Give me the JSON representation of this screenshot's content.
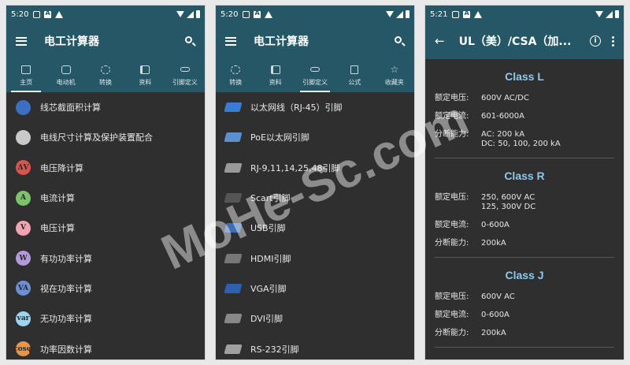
{
  "status": {
    "time_1": "5:20",
    "time_2": "5:20",
    "time_3": "5:21"
  },
  "screen1": {
    "title": "电工计算器",
    "tabs": [
      {
        "label": "主页",
        "icon": "home-icon"
      },
      {
        "label": "电动机",
        "icon": "motor-icon"
      },
      {
        "label": "转换",
        "icon": "convert-icon"
      },
      {
        "label": "资料",
        "icon": "book-icon"
      },
      {
        "label": "引脚定义",
        "icon": "pinout-icon"
      }
    ],
    "items": [
      {
        "label": "线芯截面积计算",
        "badge": "",
        "color": "#3b6fc4"
      },
      {
        "label": "电线尺寸计算及保护装置配合",
        "badge": "",
        "color": "#c9c9c9"
      },
      {
        "label": "电压降计算",
        "badge": "ΔV",
        "color": "#d9534f"
      },
      {
        "label": "电流计算",
        "badge": "A",
        "color": "#7cc36b"
      },
      {
        "label": "电压计算",
        "badge": "V",
        "color": "#f2a2b0"
      },
      {
        "label": "有功功率计算",
        "badge": "W",
        "color": "#b49ad9"
      },
      {
        "label": "视在功率计算",
        "badge": "VA",
        "color": "#6f8fd4"
      },
      {
        "label": "无功功率计算",
        "badge": "var",
        "color": "#9ed6f2"
      },
      {
        "label": "功率因数计算",
        "badge": "cosφ",
        "color": "#e8964b"
      }
    ]
  },
  "screen2": {
    "title": "电工计算器",
    "tabs": [
      {
        "label": "转换",
        "icon": "convert-icon"
      },
      {
        "label": "资料",
        "icon": "book-icon"
      },
      {
        "label": "引脚定义",
        "icon": "pinout-icon"
      },
      {
        "label": "公式",
        "icon": "formula-icon"
      },
      {
        "label": "收藏夹",
        "icon": "star-icon"
      }
    ],
    "items": [
      {
        "label": "以太网线（RJ-45）引脚",
        "color": "#3a7bd5"
      },
      {
        "label": "PoE以太网引脚",
        "color": "#5b8fd0"
      },
      {
        "label": "RJ-9,11,14,25,48引脚",
        "color": "#9a9a9a"
      },
      {
        "label": "Scart引脚",
        "color": "#555555"
      },
      {
        "label": "USB引脚",
        "color": "#3c6fb8"
      },
      {
        "label": "HDMI引脚",
        "color": "#777777"
      },
      {
        "label": "VGA引脚",
        "color": "#2f5fb0"
      },
      {
        "label": "DVI引脚",
        "color": "#888888"
      },
      {
        "label": "RS-232引脚",
        "color": "#a0a0a0"
      }
    ]
  },
  "screen3": {
    "title": "UL（美）/CSA（加...",
    "classes": [
      {
        "name": "Class L",
        "rows": [
          {
            "label": "额定电压:",
            "value": "600V AC/DC"
          },
          {
            "label": "额定电流:",
            "value": "601-6000A"
          },
          {
            "label": "分断能力:",
            "value": "AC: 200 kA\nDC: 50, 100, 200 kA"
          }
        ]
      },
      {
        "name": "Class R",
        "rows": [
          {
            "label": "额定电压:",
            "value": "250, 600V AC\n125, 300V DC"
          },
          {
            "label": "额定电流:",
            "value": "0-600A"
          },
          {
            "label": "分断能力:",
            "value": "200kA"
          }
        ]
      },
      {
        "name": "Class J",
        "rows": [
          {
            "label": "额定电压:",
            "value": "600V AC"
          },
          {
            "label": "额定电流:",
            "value": "0-600A"
          },
          {
            "label": "分断能力:",
            "value": "200kA"
          }
        ]
      }
    ]
  },
  "watermark": "MoHe-Sc.com"
}
